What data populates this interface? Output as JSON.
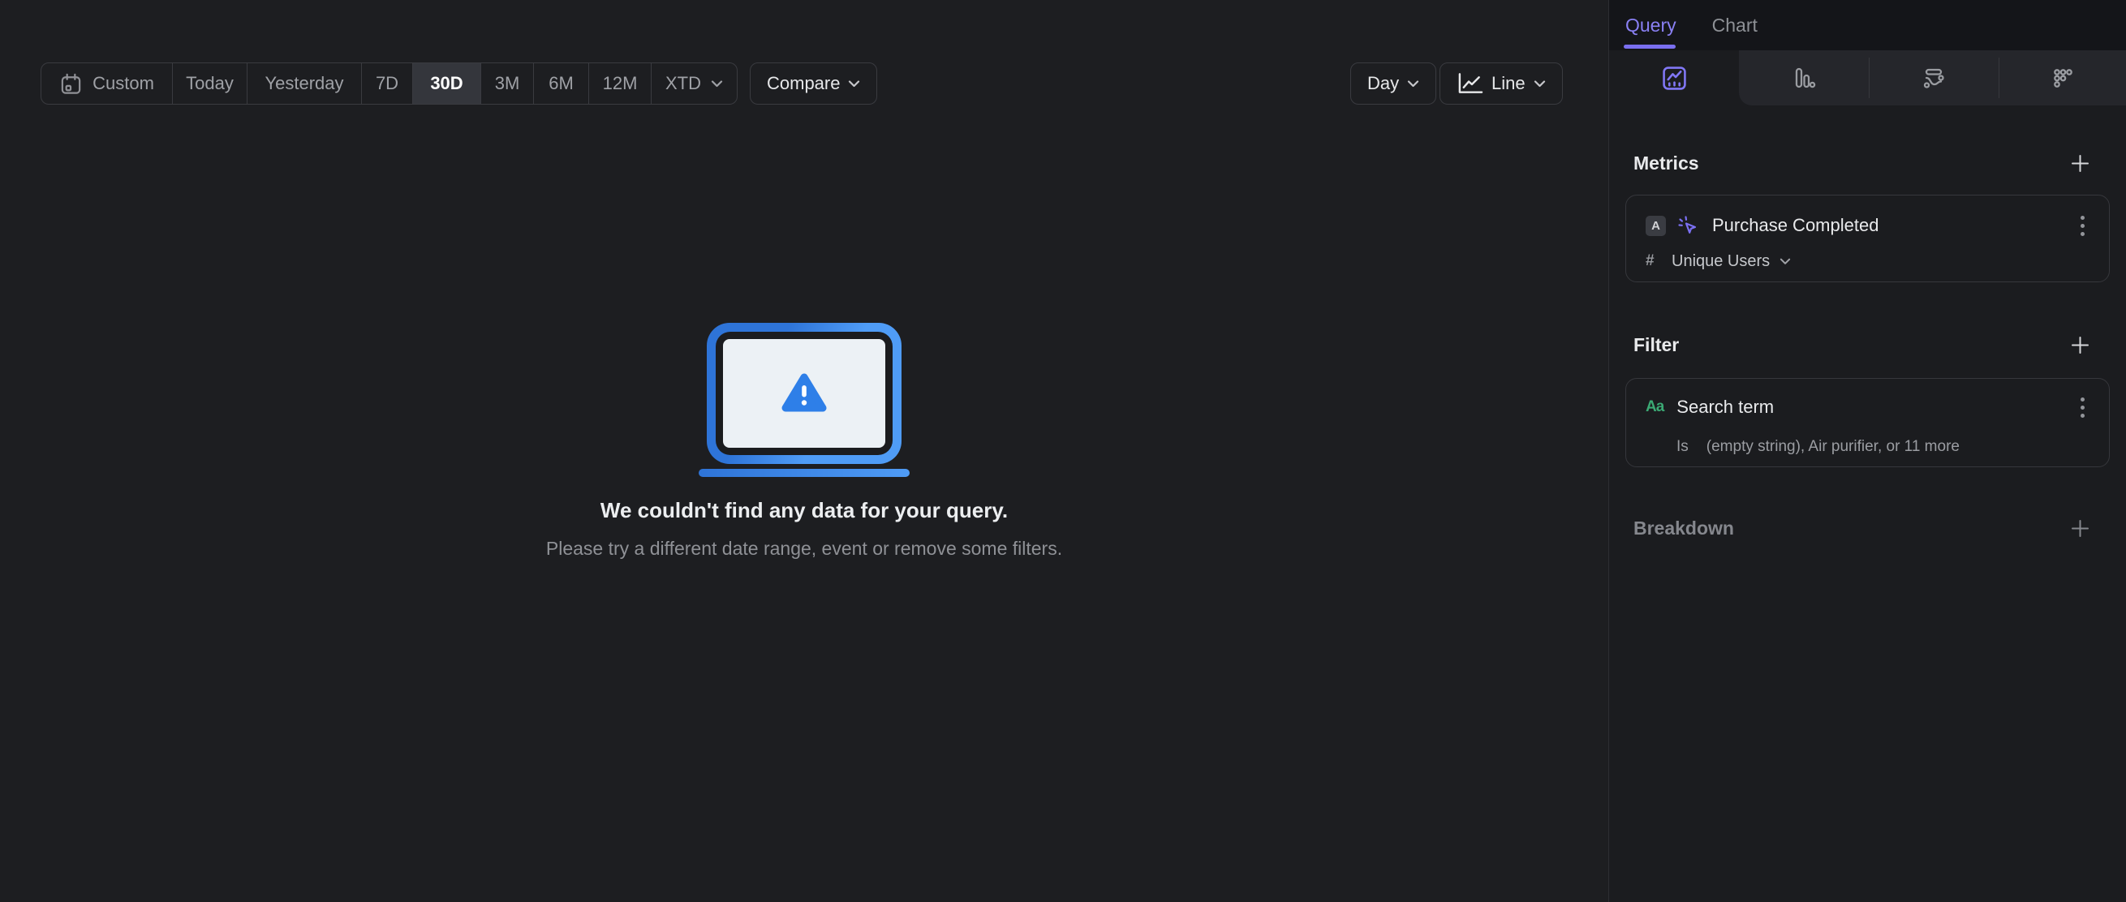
{
  "colors": {
    "accent_purple": "#8378f7",
    "illustration_blue": "#3b87ef",
    "property_green": "#3ba974",
    "active_segment_bg": "#34363c",
    "panel_bg": "#1b1c1f"
  },
  "toolbar": {
    "segments": [
      "Custom",
      "Today",
      "Yesterday",
      "7D",
      "30D",
      "3M",
      "6M",
      "12M",
      "XTD"
    ],
    "active_segment": "30D",
    "compare_label": "Compare",
    "granularity_label": "Day",
    "chart_type_label": "Line"
  },
  "empty_state": {
    "title": "We couldn't find any data for your query.",
    "subtitle": "Please try a different date range, event or remove some filters."
  },
  "sidebar": {
    "tabs": [
      {
        "label": "Query",
        "active": true
      },
      {
        "label": "Chart",
        "active": false
      }
    ],
    "chart_type_tabs": [
      "insights",
      "funnels",
      "flows",
      "retention"
    ],
    "metrics": {
      "heading": "Metrics",
      "items": [
        {
          "badge": "A",
          "icon": "event-click",
          "name": "Purchase Completed",
          "aggregation_prefix": "#",
          "aggregation": "Unique Users"
        }
      ]
    },
    "filter": {
      "heading": "Filter",
      "items": [
        {
          "type_icon": "Aa",
          "name": "Search term",
          "operator": "Is",
          "value": "(empty string), Air purifier, or 11 more"
        }
      ]
    },
    "breakdown": {
      "heading": "Breakdown"
    }
  }
}
